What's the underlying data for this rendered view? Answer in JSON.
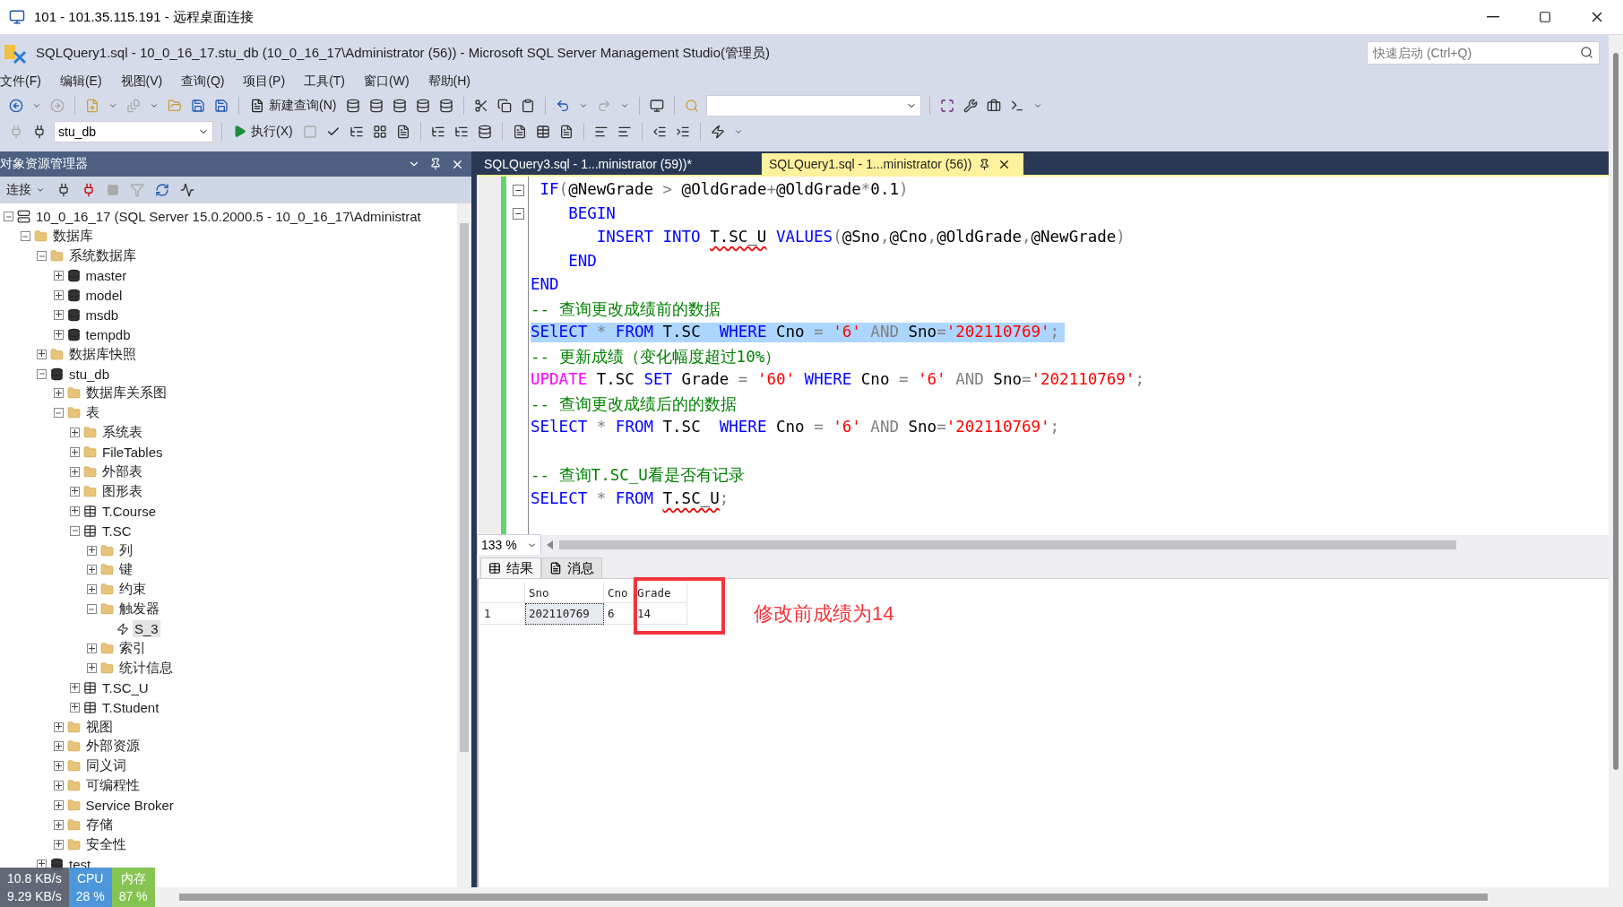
{
  "remote_window": {
    "title": "101 - 101.35.115.191 - 远程桌面连接"
  },
  "app": {
    "title": "SQLQuery1.sql - 10_0_16_17.stu_db (10_0_16_17\\Administrator (56)) - Microsoft SQL Server Management Studio(管理员)",
    "quick_launch": {
      "placeholder": "快速启动 (Ctrl+Q)"
    }
  },
  "menu": [
    "文件(F)",
    "编辑(E)",
    "视图(V)",
    "查询(Q)",
    "项目(P)",
    "工具(T)",
    "窗口(W)",
    "帮助(H)"
  ],
  "toolbar": {
    "new_query": "新建查询(N)",
    "database": "stu_db",
    "execute": "执行(X)"
  },
  "explorer": {
    "title": "对象资源管理器",
    "connect": "连接",
    "tree": [
      {
        "label": "10_0_16_17 (SQL Server 15.0.2000.5 - 10_0_16_17\\Administrat",
        "kind": "server",
        "expanded": true,
        "selected": false,
        "children": [
          {
            "label": "数据库",
            "kind": "folder",
            "expanded": true,
            "selected": false,
            "children": [
              {
                "label": "系统数据库",
                "kind": "folder",
                "expanded": true,
                "selected": false,
                "children": [
                  {
                    "label": "master",
                    "kind": "database",
                    "expanded": false,
                    "selected": false
                  },
                  {
                    "label": "model",
                    "kind": "database",
                    "expanded": false,
                    "selected": false
                  },
                  {
                    "label": "msdb",
                    "kind": "database",
                    "expanded": false,
                    "selected": false
                  },
                  {
                    "label": "tempdb",
                    "kind": "database",
                    "expanded": false,
                    "selected": false
                  }
                ]
              },
              {
                "label": "数据库快照",
                "kind": "folder",
                "expanded": false,
                "selected": false
              },
              {
                "label": "stu_db",
                "kind": "database",
                "expanded": true,
                "selected": false,
                "children": [
                  {
                    "label": "数据库关系图",
                    "kind": "folder",
                    "expanded": false,
                    "selected": false
                  },
                  {
                    "label": "表",
                    "kind": "folder",
                    "expanded": true,
                    "selected": false,
                    "children": [
                      {
                        "label": "系统表",
                        "kind": "folder",
                        "expanded": false,
                        "selected": false
                      },
                      {
                        "label": "FileTables",
                        "kind": "folder",
                        "expanded": false,
                        "selected": false
                      },
                      {
                        "label": "外部表",
                        "kind": "folder",
                        "expanded": false,
                        "selected": false
                      },
                      {
                        "label": "图形表",
                        "kind": "folder",
                        "expanded": false,
                        "selected": false
                      },
                      {
                        "label": "T.Course",
                        "kind": "table",
                        "expanded": false,
                        "selected": false
                      },
                      {
                        "label": "T.SC",
                        "kind": "table",
                        "expanded": true,
                        "selected": false,
                        "children": [
                          {
                            "label": "列",
                            "kind": "folder",
                            "expanded": false,
                            "selected": false
                          },
                          {
                            "label": "键",
                            "kind": "folder",
                            "expanded": false,
                            "selected": false
                          },
                          {
                            "label": "约束",
                            "kind": "folder",
                            "expanded": false,
                            "selected": false
                          },
                          {
                            "label": "触发器",
                            "kind": "folder",
                            "expanded": true,
                            "selected": false,
                            "children": [
                              {
                                "label": "S_3",
                                "kind": "trigger",
                                "selected": true
                              }
                            ]
                          },
                          {
                            "label": "索引",
                            "kind": "folder",
                            "expanded": false,
                            "selected": false
                          },
                          {
                            "label": "统计信息",
                            "kind": "folder",
                            "expanded": false,
                            "selected": false
                          }
                        ]
                      },
                      {
                        "label": "T.SC_U",
                        "kind": "table",
                        "expanded": false,
                        "selected": false
                      },
                      {
                        "label": "T.Student",
                        "kind": "table",
                        "expanded": false,
                        "selected": false
                      }
                    ]
                  },
                  {
                    "label": "视图",
                    "kind": "folder",
                    "expanded": false,
                    "selected": false
                  },
                  {
                    "label": "外部资源",
                    "kind": "folder",
                    "expanded": false,
                    "selected": false
                  },
                  {
                    "label": "同义词",
                    "kind": "folder",
                    "expanded": false,
                    "selected": false
                  },
                  {
                    "label": "可编程性",
                    "kind": "folder",
                    "expanded": false,
                    "selected": false
                  },
                  {
                    "label": "Service Broker",
                    "kind": "folder",
                    "expanded": false,
                    "selected": false
                  },
                  {
                    "label": "存储",
                    "kind": "folder",
                    "expanded": false,
                    "selected": false
                  },
                  {
                    "label": "安全性",
                    "kind": "folder",
                    "expanded": false,
                    "selected": false
                  }
                ]
              },
              {
                "label": "test",
                "kind": "database",
                "expanded": false,
                "selected": false
              }
            ]
          }
        ]
      }
    ]
  },
  "tabs": [
    {
      "label": "SQLQuery3.sql - 1...ministrator (59))*",
      "selected": false
    },
    {
      "label": "SQLQuery1.sql - 1...ministrator (56))",
      "selected": true
    }
  ],
  "editor": {
    "zoom": "133 %",
    "lines": [
      {
        "collapsible": true,
        "selected": false,
        "tokens": [
          {
            "kind": "kw",
            "text": " IF"
          },
          {
            "kind": "op",
            "text": "("
          },
          {
            "kind": "plain",
            "text": "@NewGrade "
          },
          {
            "kind": "op",
            "text": "> "
          },
          {
            "kind": "plain",
            "text": "@OldGrade"
          },
          {
            "kind": "op",
            "text": "+"
          },
          {
            "kind": "plain",
            "text": "@OldGrade"
          },
          {
            "kind": "op",
            "text": "*"
          },
          {
            "kind": "plain",
            "text": "0.1"
          },
          {
            "kind": "op",
            "text": ")"
          }
        ]
      },
      {
        "collapsible": true,
        "selected": false,
        "tokens": [
          {
            "kind": "kw",
            "text": "    BEGIN"
          }
        ]
      },
      {
        "collapsible": false,
        "selected": false,
        "tokens": [
          {
            "kind": "kw",
            "text": "       INSERT INTO "
          },
          {
            "kind": "error",
            "text": "T.SC_U"
          },
          {
            "kind": "kw",
            "text": " VALUES"
          },
          {
            "kind": "op",
            "text": "("
          },
          {
            "kind": "plain",
            "text": "@Sno"
          },
          {
            "kind": "op",
            "text": ","
          },
          {
            "kind": "plain",
            "text": "@Cno"
          },
          {
            "kind": "op",
            "text": ","
          },
          {
            "kind": "plain",
            "text": "@OldGrade"
          },
          {
            "kind": "op",
            "text": ","
          },
          {
            "kind": "plain",
            "text": "@NewGrade"
          },
          {
            "kind": "op",
            "text": ")"
          }
        ]
      },
      {
        "collapsible": false,
        "selected": false,
        "tokens": [
          {
            "kind": "kw",
            "text": "    END"
          }
        ]
      },
      {
        "collapsible": false,
        "selected": false,
        "tokens": [
          {
            "kind": "kw",
            "text": "END"
          }
        ]
      },
      {
        "collapsible": false,
        "selected": false,
        "tokens": [
          {
            "kind": "cmt",
            "text": "-- 查询更改成绩前的数据"
          }
        ]
      },
      {
        "collapsible": false,
        "selected": true,
        "tokens": [
          {
            "kind": "kw",
            "text": "SElECT "
          },
          {
            "kind": "op",
            "text": "* "
          },
          {
            "kind": "kw",
            "text": "FROM "
          },
          {
            "kind": "plain",
            "text": "T.SC  "
          },
          {
            "kind": "kw",
            "text": "WHERE "
          },
          {
            "kind": "plain",
            "text": "Cno "
          },
          {
            "kind": "op",
            "text": "= "
          },
          {
            "kind": "str",
            "text": "'6' "
          },
          {
            "kind": "op",
            "text": "AND "
          },
          {
            "kind": "plain",
            "text": "Sno"
          },
          {
            "kind": "op",
            "text": "="
          },
          {
            "kind": "str",
            "text": "'202110769'"
          },
          {
            "kind": "op",
            "text": ";"
          }
        ]
      },
      {
        "collapsible": false,
        "selected": false,
        "tokens": [
          {
            "kind": "cmt",
            "text": "-- 更新成绩（变化幅度超过10%）"
          }
        ]
      },
      {
        "collapsible": false,
        "selected": false,
        "tokens": [
          {
            "kind": "fn",
            "text": "UPDATE "
          },
          {
            "kind": "plain",
            "text": "T.SC "
          },
          {
            "kind": "kw",
            "text": "SET "
          },
          {
            "kind": "plain",
            "text": "Grade "
          },
          {
            "kind": "op",
            "text": "= "
          },
          {
            "kind": "str",
            "text": "'60' "
          },
          {
            "kind": "kw",
            "text": "WHERE "
          },
          {
            "kind": "plain",
            "text": "Cno "
          },
          {
            "kind": "op",
            "text": "= "
          },
          {
            "kind": "str",
            "text": "'6' "
          },
          {
            "kind": "op",
            "text": "AND "
          },
          {
            "kind": "plain",
            "text": "Sno"
          },
          {
            "kind": "op",
            "text": "="
          },
          {
            "kind": "str",
            "text": "'202110769'"
          },
          {
            "kind": "op",
            "text": ";"
          }
        ]
      },
      {
        "collapsible": false,
        "selected": false,
        "tokens": [
          {
            "kind": "cmt",
            "text": "-- 查询更改成绩后的的数据"
          }
        ]
      },
      {
        "collapsible": false,
        "selected": false,
        "tokens": [
          {
            "kind": "kw",
            "text": "SElECT "
          },
          {
            "kind": "op",
            "text": "* "
          },
          {
            "kind": "kw",
            "text": "FROM "
          },
          {
            "kind": "plain",
            "text": "T.SC  "
          },
          {
            "kind": "kw",
            "text": "WHERE "
          },
          {
            "kind": "plain",
            "text": "Cno "
          },
          {
            "kind": "op",
            "text": "= "
          },
          {
            "kind": "str",
            "text": "'6' "
          },
          {
            "kind": "op",
            "text": "AND "
          },
          {
            "kind": "plain",
            "text": "Sno"
          },
          {
            "kind": "op",
            "text": "="
          },
          {
            "kind": "str",
            "text": "'202110769'"
          },
          {
            "kind": "op",
            "text": ";"
          }
        ]
      },
      {
        "collapsible": false,
        "selected": false
      },
      {
        "collapsible": false,
        "selected": false,
        "tokens": [
          {
            "kind": "cmt",
            "text": "-- 查询T.SC_U看是否有记录"
          }
        ]
      },
      {
        "collapsible": false,
        "selected": false,
        "tokens": [
          {
            "kind": "kw",
            "text": "SELECT "
          },
          {
            "kind": "op",
            "text": "* "
          },
          {
            "kind": "kw",
            "text": "FROM "
          },
          {
            "kind": "error",
            "text": "T.SC_U"
          },
          {
            "kind": "op",
            "text": ";"
          }
        ]
      }
    ]
  },
  "results": {
    "tabs": [
      {
        "label": "结果",
        "selected": true
      },
      {
        "label": "消息",
        "selected": false
      }
    ],
    "columns": [
      "Sno",
      "Cno",
      "Grade"
    ],
    "rows": [
      {
        "number": "1",
        "cells": [
          "202110769",
          "6",
          "14"
        ]
      }
    ],
    "annotation": "修改前成绩为14"
  },
  "network_widget": {
    "download": "10.8 KB/s",
    "upload": "9.29 KB/s",
    "cpu_label": "CPU",
    "cpu": "28 %",
    "memory_label": "内存",
    "memory": "87 %"
  }
}
